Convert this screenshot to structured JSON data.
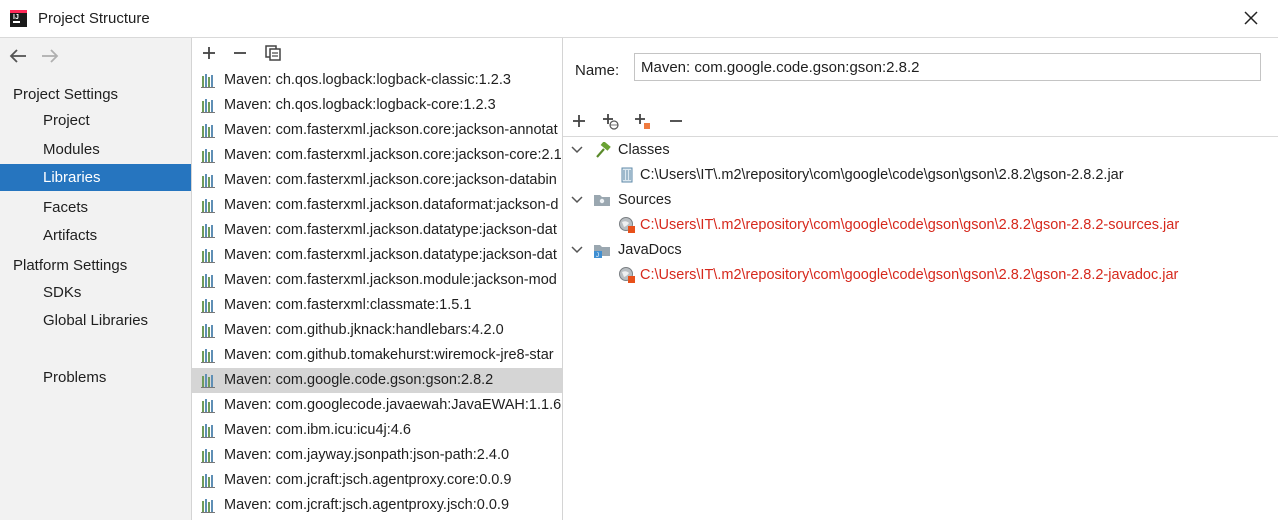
{
  "window": {
    "title": "Project Structure"
  },
  "nav": {
    "project_settings_header": "Project Settings",
    "project_settings_items": [
      "Project",
      "Modules",
      "Libraries",
      "Facets",
      "Artifacts"
    ],
    "platform_settings_header": "Platform Settings",
    "platform_settings_items": [
      "SDKs",
      "Global Libraries"
    ],
    "problems": "Problems",
    "selected": "Libraries"
  },
  "libraries": [
    "Maven: ch.qos.logback:logback-classic:1.2.3",
    "Maven: ch.qos.logback:logback-core:1.2.3",
    "Maven: com.fasterxml.jackson.core:jackson-annotat",
    "Maven: com.fasterxml.jackson.core:jackson-core:2.1",
    "Maven: com.fasterxml.jackson.core:jackson-databin",
    "Maven: com.fasterxml.jackson.dataformat:jackson-d",
    "Maven: com.fasterxml.jackson.datatype:jackson-dat",
    "Maven: com.fasterxml.jackson.datatype:jackson-dat",
    "Maven: com.fasterxml.jackson.module:jackson-mod",
    "Maven: com.fasterxml:classmate:1.5.1",
    "Maven: com.github.jknack:handlebars:4.2.0",
    "Maven: com.github.tomakehurst:wiremock-jre8-star",
    "Maven: com.google.code.gson:gson:2.8.2",
    "Maven: com.googlecode.javaewah:JavaEWAH:1.1.6",
    "Maven: com.ibm.icu:icu4j:4.6",
    "Maven: com.jayway.jsonpath:json-path:2.4.0",
    "Maven: com.jcraft:jsch.agentproxy.core:0.0.9",
    "Maven: com.jcraft:jsch.agentproxy.jsch:0.0.9"
  ],
  "selected_library_index": 12,
  "detail": {
    "name_label": "Name:",
    "name_value": "Maven: com.google.code.gson:gson:2.8.2",
    "roots": {
      "classes": {
        "label": "Classes",
        "path": "C:\\Users\\IT\\.m2\\repository\\com\\google\\code\\gson\\gson\\2.8.2\\gson-2.8.2.jar"
      },
      "sources": {
        "label": "Sources",
        "path": "C:\\Users\\IT\\.m2\\repository\\com\\google\\code\\gson\\gson\\2.8.2\\gson-2.8.2-sources.jar"
      },
      "javadocs": {
        "label": "JavaDocs",
        "path": "C:\\Users\\IT\\.m2\\repository\\com\\google\\code\\gson\\gson\\2.8.2\\gson-2.8.2-javadoc.jar"
      }
    }
  },
  "colors": {
    "selection_blue": "#2675bf",
    "missing_path_red": "#d6281c",
    "list_selection_gray": "#d5d5d5"
  }
}
